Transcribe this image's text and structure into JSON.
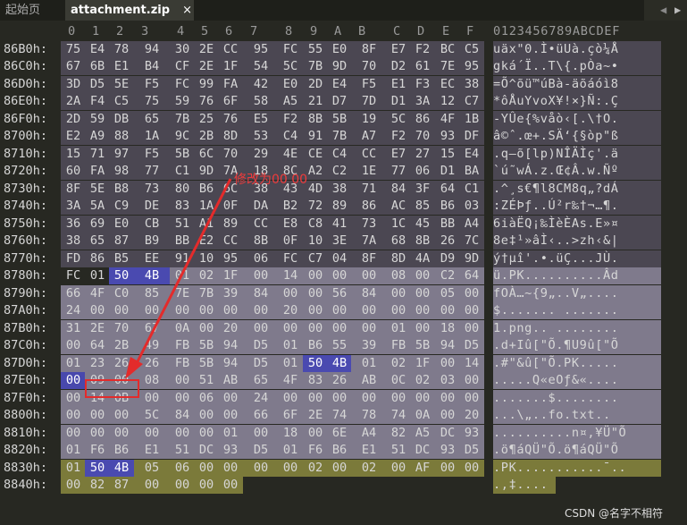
{
  "tabs": {
    "home_label": "起始页",
    "active_label": "attachment.zip",
    "close_glyph": "×"
  },
  "ruler": {
    "columns": [
      "0",
      "1",
      "2",
      "3",
      "4",
      "5",
      "6",
      "7",
      "8",
      "9",
      "A",
      "B",
      "C",
      "D",
      "E",
      "F"
    ],
    "ascii_header": "0123456789ABCDEF"
  },
  "rows": [
    {
      "offset": "86B0h:",
      "bytes": [
        "75",
        "E4",
        "78",
        "94",
        "30",
        "2E",
        "CC",
        "95",
        "FC",
        "55",
        "E0",
        "8F",
        "E7",
        "F2",
        "BC",
        "C5"
      ],
      "ascii": "uäx\"0.Ì•üUà.çò¼Å"
    },
    {
      "offset": "86C0h:",
      "bytes": [
        "67",
        "6B",
        "E1",
        "B4",
        "CF",
        "2E",
        "1F",
        "54",
        "5C",
        "7B",
        "9D",
        "70",
        "D2",
        "61",
        "7E",
        "95"
      ],
      "ascii": "gká´Ï..T\\{.pÒa~•"
    },
    {
      "offset": "86D0h:",
      "bytes": [
        "3D",
        "D5",
        "5E",
        "F5",
        "FC",
        "99",
        "FA",
        "42",
        "E0",
        "2D",
        "E4",
        "F5",
        "E1",
        "F3",
        "EC",
        "38"
      ],
      "ascii": "=Õ^õü™úBà-äõáóì8"
    },
    {
      "offset": "86E0h:",
      "bytes": [
        "2A",
        "F4",
        "C5",
        "75",
        "59",
        "76",
        "6F",
        "58",
        "A5",
        "21",
        "D7",
        "7D",
        "D1",
        "3A",
        "12",
        "C7"
      ],
      "ascii": "*ôÅuYvoX¥!×}Ñ:.Ç"
    },
    {
      "offset": "86F0h:",
      "bytes": [
        "2D",
        "59",
        "DB",
        "65",
        "7B",
        "25",
        "76",
        "E5",
        "F2",
        "8B",
        "5B",
        "19",
        "5C",
        "86",
        "4F",
        "1B"
      ],
      "ascii": "-YÛe{%våò‹[.\\†O."
    },
    {
      "offset": "8700h:",
      "bytes": [
        "E2",
        "A9",
        "88",
        "1A",
        "9C",
        "2B",
        "8D",
        "53",
        "C4",
        "91",
        "7B",
        "A7",
        "F2",
        "70",
        "93",
        "DF"
      ],
      "ascii": "â©ˆ.œ+.SÄ‘{§òp\"ß"
    },
    {
      "offset": "8710h:",
      "bytes": [
        "15",
        "71",
        "97",
        "F5",
        "5B",
        "6C",
        "70",
        "29",
        "4E",
        "CE",
        "C4",
        "CC",
        "E7",
        "27",
        "15",
        "E4"
      ],
      "ascii": ".q—õ[lp)NÎÄÌç'.ä"
    },
    {
      "offset": "8720h:",
      "bytes": [
        "60",
        "FA",
        "98",
        "77",
        "C1",
        "9D",
        "7A",
        "18",
        "8C",
        "A2",
        "C2",
        "1E",
        "77",
        "06",
        "D1",
        "BA"
      ],
      "ascii": "`ú˜wÁ.z.Œ¢Â.w.Ñº"
    },
    {
      "offset": "8730h:",
      "bytes": [
        "8F",
        "5E",
        "B8",
        "73",
        "80",
        "B6",
        "6C",
        "38",
        "43",
        "4D",
        "38",
        "71",
        "84",
        "3F",
        "64",
        "C1"
      ],
      "ascii": ".^¸s€¶l8CM8q„?dÁ"
    },
    {
      "offset": "8740h:",
      "bytes": [
        "3A",
        "5A",
        "C9",
        "DE",
        "83",
        "1A",
        "0F",
        "DA",
        "B2",
        "72",
        "89",
        "86",
        "AC",
        "85",
        "B6",
        "03"
      ],
      "ascii": ":ZÉÞƒ..Ú²r‰†¬…¶."
    },
    {
      "offset": "8750h:",
      "bytes": [
        "36",
        "69",
        "E0",
        "CB",
        "51",
        "A1",
        "89",
        "CC",
        "E8",
        "C8",
        "41",
        "73",
        "1C",
        "45",
        "BB",
        "A4"
      ],
      "ascii": "6iàËQ¡‰ÌèÈAs.E»¤"
    },
    {
      "offset": "8760h:",
      "bytes": [
        "38",
        "65",
        "87",
        "B9",
        "BB",
        "E2",
        "CC",
        "8B",
        "0F",
        "10",
        "3E",
        "7A",
        "68",
        "8B",
        "26",
        "7C"
      ],
      "ascii": "8e‡¹»âÌ‹..>zh‹&|"
    },
    {
      "offset": "8770h:",
      "bytes": [
        "FD",
        "86",
        "B5",
        "EE",
        "91",
        "10",
        "95",
        "06",
        "FC",
        "C7",
        "04",
        "8F",
        "8D",
        "4A",
        "D9",
        "9D"
      ],
      "ascii": "ý†µî'.•.üÇ...JÙ."
    },
    {
      "offset": "8780h:",
      "bytes": [
        "FC",
        "01",
        "50",
        "4B",
        "01",
        "02",
        "1F",
        "00",
        "14",
        "00",
        "00",
        "00",
        "08",
        "00",
        "C2",
        "64"
      ],
      "ascii": "ü.PK..........Âd"
    },
    {
      "offset": "8790h:",
      "bytes": [
        "66",
        "4F",
        "C0",
        "85",
        "7E",
        "7B",
        "39",
        "84",
        "00",
        "00",
        "56",
        "84",
        "00",
        "00",
        "05",
        "00"
      ],
      "ascii": "fOÀ…~{9„..V„...."
    },
    {
      "offset": "87A0h:",
      "bytes": [
        "24",
        "00",
        "00",
        "00",
        "00",
        "00",
        "00",
        "00",
        "20",
        "00",
        "00",
        "00",
        "00",
        "00",
        "00",
        "00"
      ],
      "ascii": "$....... ......."
    },
    {
      "offset": "87B0h:",
      "bytes": [
        "31",
        "2E",
        "70",
        "67",
        "0A",
        "00",
        "20",
        "00",
        "00",
        "00",
        "00",
        "00",
        "01",
        "00",
        "18",
        "00"
      ],
      "ascii": "1.png.. ........"
    },
    {
      "offset": "87C0h:",
      "bytes": [
        "00",
        "64",
        "2B",
        "49",
        "FB",
        "5B",
        "94",
        "D5",
        "01",
        "B6",
        "55",
        "39",
        "FB",
        "5B",
        "94",
        "D5"
      ],
      "ascii": ".d+Iû[\"Õ.¶U9û[\"Õ"
    },
    {
      "offset": "87D0h:",
      "bytes": [
        "01",
        "23",
        "26",
        "26",
        "FB",
        "5B",
        "94",
        "D5",
        "01",
        "50",
        "4B",
        "01",
        "02",
        "1F",
        "00",
        "14"
      ],
      "ascii": ".#\"&û[\"Õ.PK....."
    },
    {
      "offset": "87E0h:",
      "bytes": [
        "00",
        "09",
        "00",
        "08",
        "00",
        "51",
        "AB",
        "65",
        "4F",
        "83",
        "26",
        "AB",
        "0C",
        "02",
        "03",
        "00"
      ],
      "ascii": ".....Q«eOƒ&«...."
    },
    {
      "offset": "87F0h:",
      "bytes": [
        "00",
        "14",
        "0B",
        "00",
        "00",
        "06",
        "00",
        "24",
        "00",
        "00",
        "00",
        "00",
        "00",
        "00",
        "00",
        "00"
      ],
      "ascii": ".......$........"
    },
    {
      "offset": "8800h:",
      "bytes": [
        "00",
        "00",
        "00",
        "5C",
        "84",
        "00",
        "00",
        "66",
        "6F",
        "2E",
        "74",
        "78",
        "74",
        "0A",
        "00",
        "20"
      ],
      "ascii": "...\\„..fo.txt.. "
    },
    {
      "offset": "8810h:",
      "bytes": [
        "00",
        "00",
        "00",
        "00",
        "00",
        "00",
        "01",
        "00",
        "18",
        "00",
        "6E",
        "A4",
        "82",
        "A5",
        "DC",
        "93",
        "D5"
      ],
      "ascii": "..........n¤‚¥Ü\"Õ"
    },
    {
      "offset": "8820h:",
      "bytes": [
        "01",
        "F6",
        "B6",
        "E1",
        "51",
        "DC",
        "93",
        "D5",
        "01",
        "F6",
        "B6",
        "E1",
        "51",
        "DC",
        "93",
        "D5"
      ],
      "ascii": ".ö¶áQÜ\"Õ.ö¶áQÜ\"Õ"
    },
    {
      "offset": "8830h:",
      "bytes": [
        "01",
        "50",
        "4B",
        "05",
        "06",
        "00",
        "00",
        "00",
        "00",
        "02",
        "00",
        "02",
        "00",
        "AF",
        "00",
        "00"
      ],
      "ascii": ".PK...........¯.."
    },
    {
      "offset": "8840h:",
      "bytes": [
        "00",
        "82",
        "87",
        "00",
        "00",
        "00",
        "00",
        "",
        "",
        "",
        "",
        "",
        "",
        "",
        "",
        ""
      ],
      "ascii": ".‚‡...."
    }
  ],
  "annotation": {
    "label": "修改为00 00"
  },
  "watermark": "CSDN @名字不相符"
}
